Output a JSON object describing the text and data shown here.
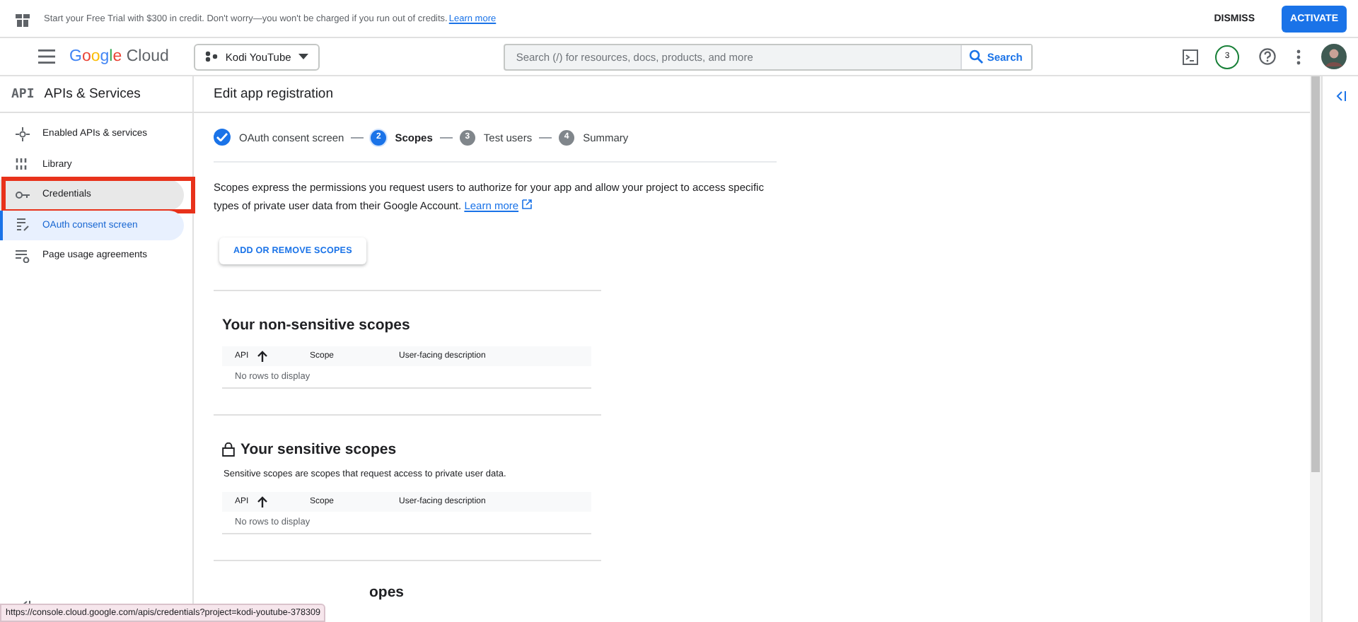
{
  "banner": {
    "text": "Start your Free Trial with $300 in credit. Don't worry—you won't be charged if you run out of credits.",
    "link": "Learn more",
    "buttons": [
      {
        "label": "DISMISS",
        "kind": "text"
      },
      {
        "label": "ACTIVATE",
        "kind": "filled"
      }
    ]
  },
  "header": {
    "logo": "Google Cloud",
    "project": "Kodi YouTube",
    "search": {
      "placeholder": "Search (/) for resources, docs, products, and more",
      "button": "Search"
    },
    "notifications": "3"
  },
  "sidebar": {
    "badge": "API",
    "title": "APIs & Services",
    "items": [
      {
        "label": "Enabled APIs & services",
        "selected": false,
        "hovered": false
      },
      {
        "label": "Library",
        "selected": false,
        "hovered": false
      },
      {
        "label": "Credentials",
        "selected": false,
        "hovered": true
      },
      {
        "label": "OAuth consent screen",
        "selected": true,
        "hovered": false
      },
      {
        "label": "Page usage agreements",
        "selected": false,
        "hovered": false
      }
    ]
  },
  "page": {
    "title": "Edit app registration",
    "steps": [
      {
        "label": "OAuth consent screen",
        "completed": true,
        "selected": false
      },
      {
        "number": "2",
        "label": "Scopes",
        "completed": false,
        "selected": true
      },
      {
        "number": "3",
        "label": "Test users",
        "completed": false,
        "selected": false
      },
      {
        "number": "4",
        "label": "Summary",
        "completed": false,
        "selected": false
      }
    ],
    "intro": "Scopes express the permissions you request users to authorize for your app and allow your project to access specific types of private user data from their Google Account.",
    "intro_link": "Learn more",
    "action": "ADD OR REMOVE SCOPES",
    "sections": [
      {
        "title": "Your non-sensitive scopes",
        "locked": false,
        "columns": [
          "API",
          "Scope",
          "User-facing description"
        ],
        "empty": "No rows to display"
      },
      {
        "title": "Your sensitive scopes",
        "locked": true,
        "description": "Sensitive scopes are scopes that request access to private user data.",
        "columns": [
          "API",
          "Scope",
          "User-facing description"
        ],
        "empty": "No rows to display"
      }
    ],
    "cut_heading": "opes"
  },
  "status_url": "https://console.cloud.google.com/apis/credentials?project=kodi-youtube-378309"
}
